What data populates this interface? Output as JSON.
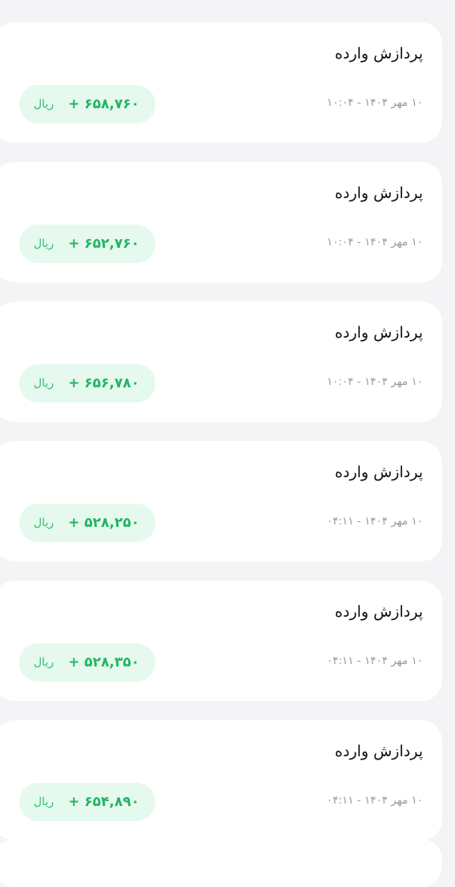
{
  "transactions": [
    {
      "title": "پردازش وارده",
      "date": "۱۰ مهر ۱۴۰۴ - ۱۰:۰۴",
      "amount": "+ ۶۵۸,۷۶۰",
      "currency": "ریال"
    },
    {
      "title": "پردازش وارده",
      "date": "۱۰ مهر ۱۴۰۴ - ۱۰:۰۴",
      "amount": "+ ۶۵۲,۷۶۰",
      "currency": "ریال"
    },
    {
      "title": "پردازش وارده",
      "date": "۱۰ مهر ۱۴۰۴ - ۱۰:۰۴",
      "amount": "+ ۶۵۶,۷۸۰",
      "currency": "ریال"
    },
    {
      "title": "پردازش وارده",
      "date": "۱۰ مهر ۱۴۰۴ - ۰۴:۱۱",
      "amount": "+ ۵۲۸,۲۵۰",
      "currency": "ریال"
    },
    {
      "title": "پردازش وارده",
      "date": "۱۰ مهر ۱۴۰۴ - ۰۴:۱۱",
      "amount": "+ ۵۲۸,۳۵۰",
      "currency": "ریال"
    },
    {
      "title": "پردازش وارده",
      "date": "۱۰ مهر ۱۴۰۴ - ۰۴:۱۱",
      "amount": "+ ۶۵۴,۸۹۰",
      "currency": "ریال"
    }
  ],
  "colors": {
    "background": "#f4f4f6",
    "card": "#ffffff",
    "amount_positive": "#22b564",
    "pill_background": "#e6f9ee",
    "muted_text": "#9a9aa0"
  }
}
